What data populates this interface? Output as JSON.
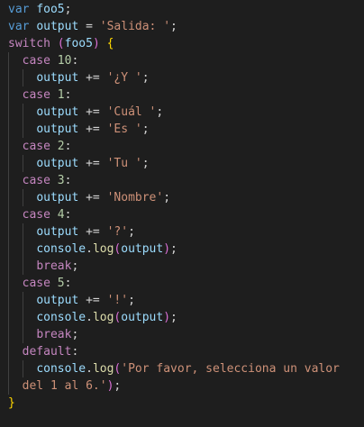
{
  "lines": [
    {
      "indent": 0,
      "tokens": [
        {
          "t": "var",
          "c": "kw"
        },
        {
          "t": " "
        },
        {
          "t": "foo5",
          "c": "var"
        },
        {
          "t": ";"
        }
      ]
    },
    {
      "indent": 0,
      "tokens": [
        {
          "t": "var",
          "c": "kw"
        },
        {
          "t": " "
        },
        {
          "t": "output",
          "c": "var"
        },
        {
          "t": " = "
        },
        {
          "t": "'Salida: '",
          "c": "str"
        },
        {
          "t": ";"
        }
      ]
    },
    {
      "indent": 0,
      "tokens": [
        {
          "t": "switch",
          "c": "ctrl"
        },
        {
          "t": " "
        },
        {
          "t": "(",
          "c": "paren"
        },
        {
          "t": "foo5",
          "c": "var"
        },
        {
          "t": ")",
          "c": "paren"
        },
        {
          "t": " "
        },
        {
          "t": "{",
          "c": "brace"
        }
      ]
    },
    {
      "indent": 1,
      "tokens": [
        {
          "t": "case",
          "c": "ctrl"
        },
        {
          "t": " "
        },
        {
          "t": "10",
          "c": "num"
        },
        {
          "t": ":"
        }
      ]
    },
    {
      "indent": 2,
      "tokens": [
        {
          "t": "output",
          "c": "var"
        },
        {
          "t": " += "
        },
        {
          "t": "'¿Y '",
          "c": "str"
        },
        {
          "t": ";"
        }
      ]
    },
    {
      "indent": 1,
      "tokens": [
        {
          "t": "case",
          "c": "ctrl"
        },
        {
          "t": " "
        },
        {
          "t": "1",
          "c": "num"
        },
        {
          "t": ":"
        }
      ]
    },
    {
      "indent": 2,
      "tokens": [
        {
          "t": "output",
          "c": "var"
        },
        {
          "t": " += "
        },
        {
          "t": "'Cuál '",
          "c": "str"
        },
        {
          "t": ";"
        }
      ]
    },
    {
      "indent": 2,
      "tokens": [
        {
          "t": "output",
          "c": "var"
        },
        {
          "t": " += "
        },
        {
          "t": "'Es '",
          "c": "str"
        },
        {
          "t": ";"
        }
      ]
    },
    {
      "indent": 1,
      "tokens": [
        {
          "t": "case",
          "c": "ctrl"
        },
        {
          "t": " "
        },
        {
          "t": "2",
          "c": "num"
        },
        {
          "t": ":"
        }
      ]
    },
    {
      "indent": 2,
      "tokens": [
        {
          "t": "output",
          "c": "var"
        },
        {
          "t": " += "
        },
        {
          "t": "'Tu '",
          "c": "str"
        },
        {
          "t": ";"
        }
      ]
    },
    {
      "indent": 1,
      "tokens": [
        {
          "t": "case",
          "c": "ctrl"
        },
        {
          "t": " "
        },
        {
          "t": "3",
          "c": "num"
        },
        {
          "t": ":"
        }
      ]
    },
    {
      "indent": 2,
      "tokens": [
        {
          "t": "output",
          "c": "var"
        },
        {
          "t": " += "
        },
        {
          "t": "'Nombre'",
          "c": "str"
        },
        {
          "t": ";"
        }
      ]
    },
    {
      "indent": 1,
      "tokens": [
        {
          "t": "case",
          "c": "ctrl"
        },
        {
          "t": " "
        },
        {
          "t": "4",
          "c": "num"
        },
        {
          "t": ":"
        }
      ]
    },
    {
      "indent": 2,
      "tokens": [
        {
          "t": "output",
          "c": "var"
        },
        {
          "t": " += "
        },
        {
          "t": "'?'",
          "c": "str"
        },
        {
          "t": ";"
        }
      ]
    },
    {
      "indent": 2,
      "tokens": [
        {
          "t": "console",
          "c": "var"
        },
        {
          "t": "."
        },
        {
          "t": "log",
          "c": "fn"
        },
        {
          "t": "(",
          "c": "paren"
        },
        {
          "t": "output",
          "c": "var"
        },
        {
          "t": ")",
          "c": "paren"
        },
        {
          "t": ";"
        }
      ]
    },
    {
      "indent": 2,
      "tokens": [
        {
          "t": "break",
          "c": "ctrl"
        },
        {
          "t": ";"
        }
      ]
    },
    {
      "indent": 1,
      "tokens": [
        {
          "t": "case",
          "c": "ctrl"
        },
        {
          "t": " "
        },
        {
          "t": "5",
          "c": "num"
        },
        {
          "t": ":"
        }
      ]
    },
    {
      "indent": 2,
      "tokens": [
        {
          "t": "output",
          "c": "var"
        },
        {
          "t": " += "
        },
        {
          "t": "'!'",
          "c": "str"
        },
        {
          "t": ";"
        }
      ]
    },
    {
      "indent": 2,
      "tokens": [
        {
          "t": "console",
          "c": "var"
        },
        {
          "t": "."
        },
        {
          "t": "log",
          "c": "fn"
        },
        {
          "t": "(",
          "c": "paren"
        },
        {
          "t": "output",
          "c": "var"
        },
        {
          "t": ")",
          "c": "paren"
        },
        {
          "t": ";"
        }
      ]
    },
    {
      "indent": 2,
      "tokens": [
        {
          "t": "break",
          "c": "ctrl"
        },
        {
          "t": ";"
        }
      ]
    },
    {
      "indent": 1,
      "tokens": [
        {
          "t": "default",
          "c": "ctrl"
        },
        {
          "t": ":"
        }
      ]
    },
    {
      "indent": 2,
      "tokens": [
        {
          "t": "console",
          "c": "var"
        },
        {
          "t": "."
        },
        {
          "t": "log",
          "c": "fn"
        },
        {
          "t": "(",
          "c": "paren"
        },
        {
          "t": "'Por favor, selecciona un valor",
          "c": "str"
        }
      ]
    },
    {
      "indent": 1,
      "tokens": [
        {
          "t": "del 1 al 6.'",
          "c": "str"
        },
        {
          "t": ")",
          "c": "paren"
        },
        {
          "t": ";"
        }
      ]
    },
    {
      "indent": 0,
      "tokens": [
        {
          "t": "}",
          "c": "brace"
        }
      ]
    }
  ],
  "colors": {
    "background": "#1e1e1e",
    "keyword": "#569cd6",
    "control": "#c586c0",
    "variable": "#9cdcfe",
    "string": "#ce9178",
    "number": "#b5cea8",
    "function": "#dcdcaa",
    "punctuation": "#d4d4d4",
    "bracket_level1": "#ffd700",
    "bracket_level2": "#da70d6"
  }
}
